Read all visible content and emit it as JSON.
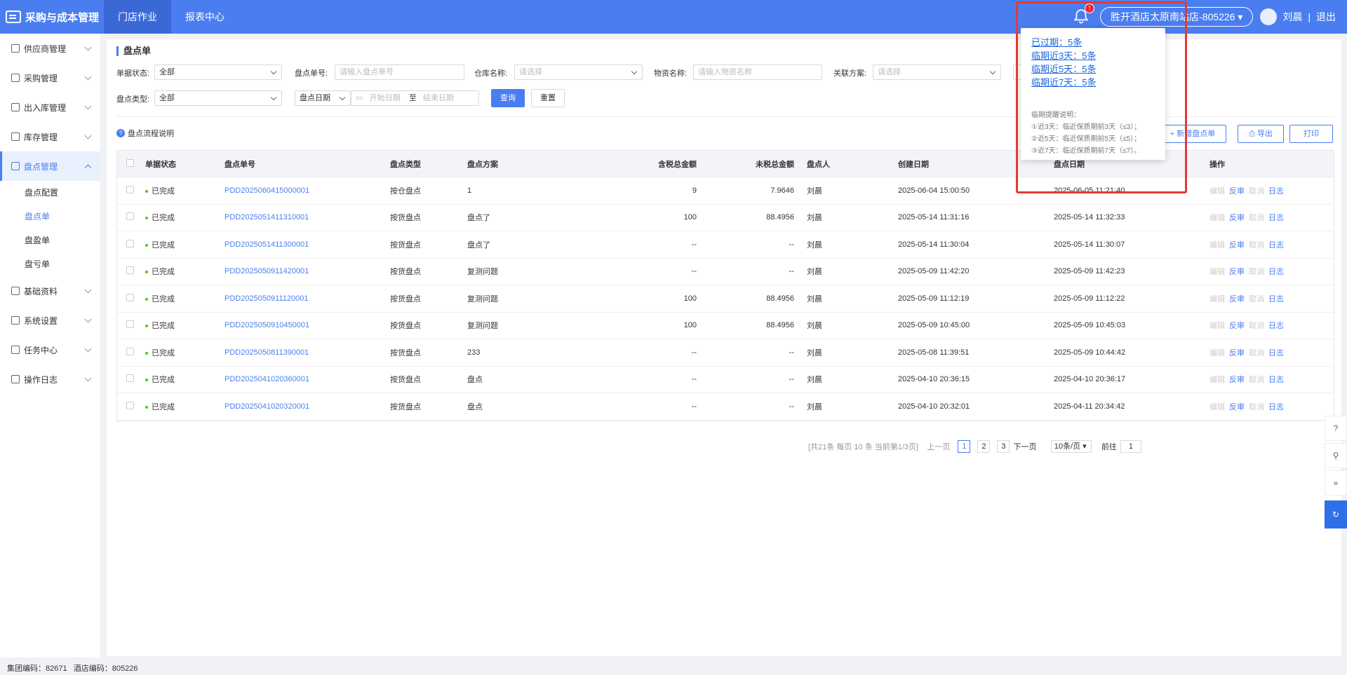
{
  "app": {
    "title": "采购与成本管理",
    "tabs": [
      "门店作业",
      "报表中心"
    ],
    "notification_count": "!",
    "store": "胜开酒店太原南站店-805226",
    "user": "刘晨",
    "separator": "|",
    "logout": "退出"
  },
  "sidebar": {
    "items": [
      {
        "label": "供应商管理"
      },
      {
        "label": "采购管理"
      },
      {
        "label": "出入库管理"
      },
      {
        "label": "库存管理"
      },
      {
        "label": "盘点管理"
      },
      {
        "label": "基础资料"
      },
      {
        "label": "系统设置"
      },
      {
        "label": "任务中心"
      },
      {
        "label": "操作日志"
      }
    ],
    "submenu": [
      "盘点配置",
      "盘点单",
      "盘盈单",
      "盘亏单"
    ]
  },
  "footer": {
    "group": "集团编码：82671",
    "hotel": "酒店编码：805226"
  },
  "page": {
    "title": "盘点单",
    "filters": {
      "status_label": "单据状态:",
      "status_value": "全部",
      "no_label": "盘点单号:",
      "no_placeholder": "请输入盘点单号",
      "warehouse_label": "仓库名称:",
      "warehouse_placeholder": "请选择",
      "material_label": "物资名称:",
      "material_placeholder": "请输入物资名称",
      "plan_label": "关联方案:",
      "plan_placeholder": "请选择",
      "type_label": "盘点类型:",
      "type_value": "全部",
      "date_type": "盘点日期",
      "start_placeholder": "开始日期",
      "to": "至",
      "end_placeholder": "结束日期",
      "query": "查询",
      "reset": "重置"
    },
    "help_link": "盘点流程说明",
    "actions": {
      "add": "+ 新增盘点单",
      "export": "导出",
      "print": "打印"
    }
  },
  "table": {
    "headers": {
      "status": "单据状态",
      "no": "盘点单号",
      "type": "盘点类型",
      "plan": "盘点方案",
      "tax": "含税总金额",
      "notax": "未税总金额",
      "user": "盘点人",
      "created": "创建日期",
      "date": "盘点日期",
      "ops": "操作"
    },
    "ops": {
      "edit": "编辑",
      "reverse": "反审",
      "cancel": "取消",
      "log": "日志"
    },
    "rows": [
      {
        "status": "已完成",
        "no": "PDD2025060415000001",
        "type": "按仓盘点",
        "plan": "1",
        "tax": "9",
        "notax": "7.9646",
        "user": "刘晨",
        "created": "2025-06-04 15:00:50",
        "date": "2025-06-05 11:21:40"
      },
      {
        "status": "已完成",
        "no": "PDD2025051411310001",
        "type": "按货盘点",
        "plan": "盘点了",
        "tax": "100",
        "notax": "88.4956",
        "user": "刘晨",
        "created": "2025-05-14 11:31:16",
        "date": "2025-05-14 11:32:33"
      },
      {
        "status": "已完成",
        "no": "PDD2025051411300001",
        "type": "按货盘点",
        "plan": "盘点了",
        "tax": "--",
        "notax": "--",
        "user": "刘晨",
        "created": "2025-05-14 11:30:04",
        "date": "2025-05-14 11:30:07"
      },
      {
        "status": "已完成",
        "no": "PDD2025050911420001",
        "type": "按货盘点",
        "plan": "复测问题",
        "tax": "--",
        "notax": "--",
        "user": "刘晨",
        "created": "2025-05-09 11:42:20",
        "date": "2025-05-09 11:42:23"
      },
      {
        "status": "已完成",
        "no": "PDD2025050911120001",
        "type": "按货盘点",
        "plan": "复测问题",
        "tax": "100",
        "notax": "88.4956",
        "user": "刘晨",
        "created": "2025-05-09 11:12:19",
        "date": "2025-05-09 11:12:22"
      },
      {
        "status": "已完成",
        "no": "PDD2025050910450001",
        "type": "按货盘点",
        "plan": "复测问题",
        "tax": "100",
        "notax": "88.4956",
        "user": "刘晨",
        "created": "2025-05-09 10:45:00",
        "date": "2025-05-09 10:45:03"
      },
      {
        "status": "已完成",
        "no": "PDD2025050811390001",
        "type": "按货盘点",
        "plan": "233",
        "tax": "--",
        "notax": "--",
        "user": "刘晨",
        "created": "2025-05-08 11:39:51",
        "date": "2025-05-09 10:44:42"
      },
      {
        "status": "已完成",
        "no": "PDD2025041020360001",
        "type": "按货盘点",
        "plan": "盘点",
        "tax": "--",
        "notax": "--",
        "user": "刘晨",
        "created": "2025-04-10 20:36:15",
        "date": "2025-04-10 20:36:17"
      },
      {
        "status": "已完成",
        "no": "PDD2025041020320001",
        "type": "按货盘点",
        "plan": "盘点",
        "tax": "--",
        "notax": "--",
        "user": "刘晨",
        "created": "2025-04-10 20:32:01",
        "date": "2025-04-11 20:34:42"
      }
    ]
  },
  "pagination": {
    "summary": "[共21条 每页 10 条 当前第1/3页]",
    "prev": "上一页",
    "pages": [
      "1",
      "2",
      "3"
    ],
    "next": "下一页",
    "size": "10条/页",
    "goto": "前往",
    "goto_value": "1"
  },
  "popover": {
    "links": [
      "已过期：5条",
      "临期近3天：5条",
      "临期近5天：5条",
      "临期近7天：5条"
    ],
    "note_title": "临期提醒说明：",
    "notes": [
      "①近3天：临近保质期前3天（≤3）；",
      "②近5天：临近保质期前5天（≤5）；",
      "③近7天：临近保质期前7天（≤7）。"
    ]
  }
}
